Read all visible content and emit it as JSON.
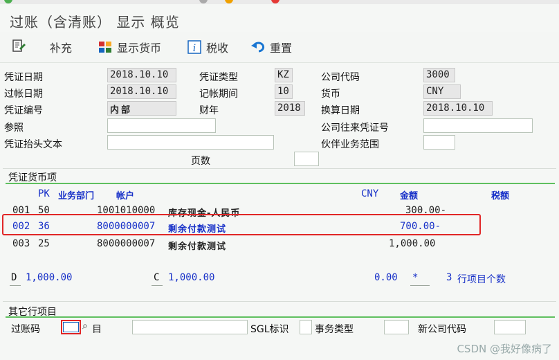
{
  "window": {
    "title": "过账（含清账） 显示 概览"
  },
  "toolbar": {
    "items": [
      {
        "label": "",
        "icon": "document-edit-icon"
      },
      {
        "label": "补充",
        "icon": ""
      },
      {
        "label": "显示货币",
        "icon": "currency-display-icon"
      },
      {
        "label": "税收",
        "icon": "info-icon"
      },
      {
        "label": "重置",
        "icon": "undo-icon"
      }
    ]
  },
  "header": {
    "doc_date_label": "凭证日期",
    "doc_date": "2018.10.10",
    "doc_type_label": "凭证类型",
    "doc_type": "KZ",
    "company_code_label": "公司代码",
    "company_code": "3000",
    "posting_date_label": "过帐日期",
    "posting_date": "2018.10.10",
    "period_label": "记帐期间",
    "period": "10",
    "currency_label": "货币",
    "currency": "CNY",
    "doc_number_label": "凭证编号",
    "doc_number": "内部",
    "fiscal_year_label": "财年",
    "fiscal_year": "2018",
    "translation_date_label": "换算日期",
    "translation_date": "2018.10.10",
    "reference_label": "参照",
    "reference": "",
    "intercompany_label": "公司往来凭证号",
    "intercompany": "",
    "header_text_label": "凭证抬头文本",
    "header_text": "",
    "trading_partner_label": "伙伴业务范围",
    "trading_partner": "",
    "pages_label": "页数",
    "pages": ""
  },
  "items": {
    "section_title": "凭证货币项",
    "columns": {
      "pk": "PK",
      "bus_area": "业务部门",
      "account": "帐户",
      "currency": "CNY",
      "amount": "金额",
      "tax": "税额"
    },
    "rows": [
      {
        "line": "001",
        "pk": "50",
        "account": "1001010000",
        "text": "库存现金-人民币",
        "amount": "300.00-"
      },
      {
        "line": "002",
        "pk": "36",
        "account": "8000000007",
        "text": "剩余付款测试",
        "amount": "700.00-"
      },
      {
        "line": "003",
        "pk": "25",
        "account": "8000000007",
        "text": "剩余付款测试",
        "amount": "1,000.00"
      }
    ],
    "totals": {
      "debit_label": "D",
      "debit": "1,000.00",
      "credit_label": "C",
      "credit": "1,000.00",
      "balance": "0.00",
      "marker": "*",
      "line_count": "3",
      "line_count_label": "行项目个数"
    }
  },
  "other_item": {
    "section_title": "其它行项目",
    "posting_key_label": "过账码",
    "posting_key": "",
    "account_label": "目",
    "account": "",
    "sgl_label": "SGL标识",
    "sgl": "",
    "trans_type_label": "事务类型",
    "trans_type": "",
    "new_company_label": "新公司代码",
    "new_company": ""
  },
  "watermark": "CSDN @我好像病了",
  "colors": {
    "accent": "#1730c8",
    "highlight": "#e12626",
    "section_line": "#5fc05f"
  }
}
